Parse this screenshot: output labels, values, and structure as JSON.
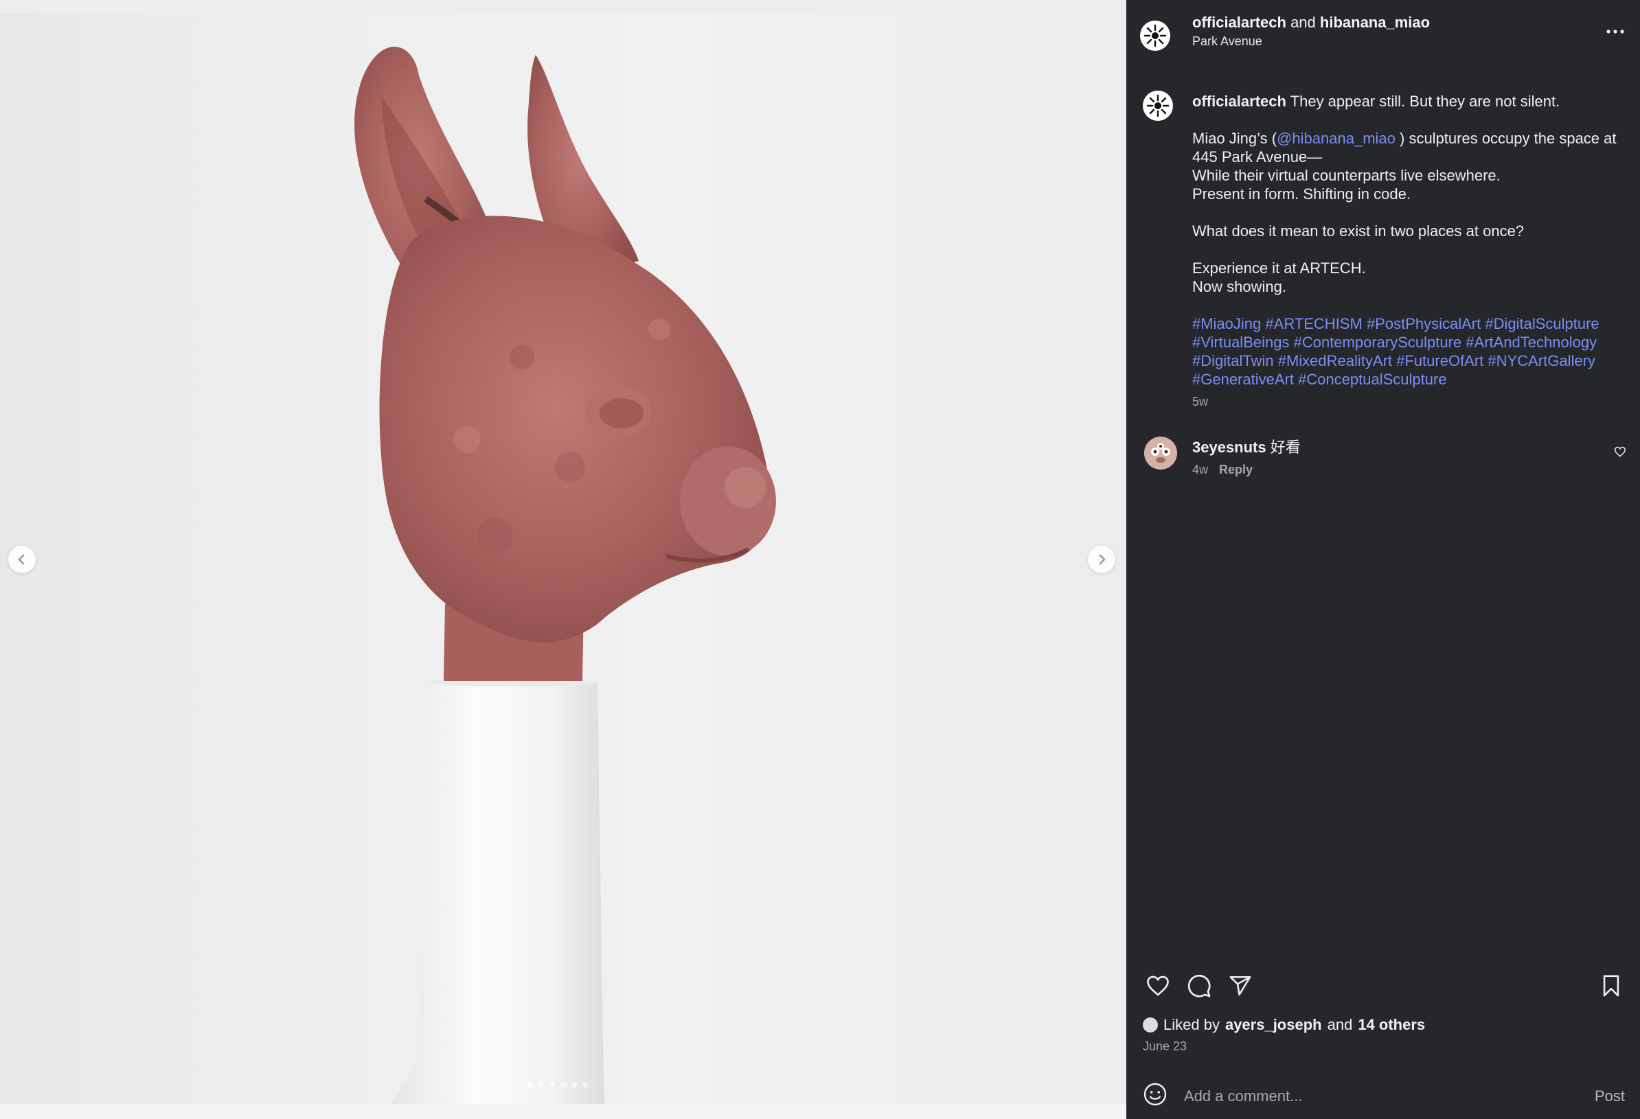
{
  "header": {
    "author": "officialartech",
    "joiner": "and",
    "collaborator": "hibanana_miao",
    "location": "Park Avenue"
  },
  "caption": {
    "username": "officialartech",
    "line1": "They appear still. But they are not silent.",
    "line2_pre": "Miao Jing’s (",
    "mention": "@hibanana_miao",
    "line2_post": " ) sculptures occupy the space at 445 Park Avenue—",
    "line3": "While their virtual counterparts live elsewhere.",
    "line4": "Present in form. Shifting in code.",
    "line5": "What does it mean to exist in two places at once?",
    "line6": "Experience it at ARTECH.",
    "line7": "Now showing.",
    "hashtags": [
      "#MiaoJing",
      "#ARTECHISM",
      "#PostPhysicalArt",
      "#DigitalSculpture",
      "#VirtualBeings",
      "#ContemporarySculpture",
      "#ArtAndTechnology",
      "#DigitalTwin",
      "#MixedRealityArt",
      "#FutureOfArt",
      "#NYCArtGallery",
      "#GenerativeArt",
      "#ConceptualSculpture"
    ],
    "time": "5w"
  },
  "comment": {
    "username": "3eyesnuts",
    "text": "好看",
    "time": "4w",
    "reply_label": "Reply"
  },
  "likes": {
    "prefix": "Liked by",
    "user": "ayers_joseph",
    "joiner": "and",
    "others": "14 others"
  },
  "date": "June 23",
  "add_comment": {
    "placeholder": "Add a comment...",
    "post_label": "Post"
  },
  "carousel": {
    "slide_count": 6,
    "active_slide": 1
  },
  "icons": {
    "prev": "chevron-left-icon",
    "next": "chevron-right-icon",
    "more": "more-horizontal-icon",
    "like": "heart-icon",
    "comment": "comment-icon",
    "share": "send-icon",
    "save": "bookmark-icon",
    "emoji": "emoji-icon"
  },
  "colors": {
    "panel_bg": "#25272b",
    "link": "#7b8ef7",
    "sculpture": "#b06c68",
    "pedestal": "#f7f7f6"
  }
}
